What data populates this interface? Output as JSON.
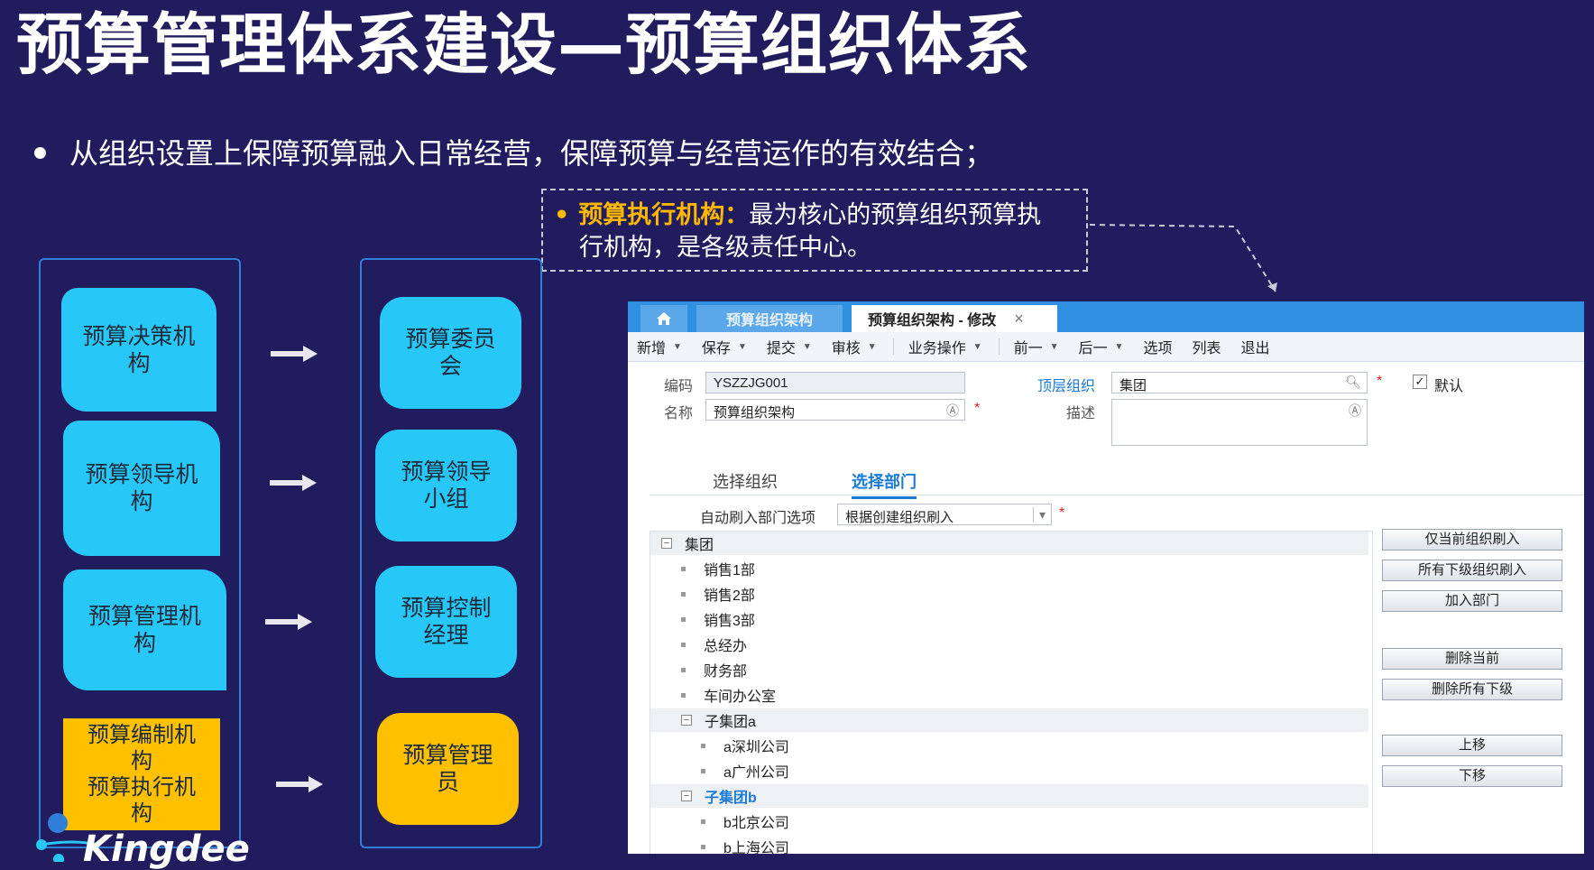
{
  "slide": {
    "title": "预算管理体系建设—预算组织体系",
    "bullet": "从组织设置上保障预算融入日常经营，保障预算与经营运作的有效结合；",
    "callout": {
      "key": "预算执行机构：",
      "text_line1": "最为核心的预算组织预算执",
      "text_line2": "行机构，是各级责任中心。"
    },
    "left_column": [
      {
        "line1": "预算决策机",
        "line2": "构"
      },
      {
        "line1": "预算领导机",
        "line2": "构"
      },
      {
        "line1": "预算管理机",
        "line2": "构"
      },
      {
        "line1": "预算编制机",
        "line2": "构",
        "line3": "预算执行机",
        "line4": "构"
      }
    ],
    "right_column": [
      {
        "line1": "预算委员",
        "line2": "会"
      },
      {
        "line1": "预算领导",
        "line2": "小组"
      },
      {
        "line1": "预算控制",
        "line2": "经理"
      },
      {
        "line1": "预算管理",
        "line2": "员"
      }
    ],
    "logo_text": "Kingdee",
    "colors": {
      "background": "#211c5e",
      "cyan": "#27c8f7",
      "yellow": "#ffc000",
      "accent_orange": "#ffb800"
    }
  },
  "app": {
    "tabs": [
      {
        "icon": "home-icon"
      },
      {
        "label": "预算组织架构"
      },
      {
        "label": "预算组织架构 - 修改",
        "close": "×"
      }
    ],
    "toolbar": [
      {
        "label": "新增",
        "dropdown": true
      },
      {
        "label": "保存",
        "dropdown": true
      },
      {
        "label": "提交",
        "dropdown": true
      },
      {
        "label": "审核",
        "dropdown": true
      },
      {
        "label": "业务操作",
        "dropdown": true
      },
      {
        "label": "前一",
        "dropdown": true
      },
      {
        "label": "后一",
        "dropdown": true
      },
      {
        "label": "选项",
        "dropdown": false
      },
      {
        "label": "列表",
        "dropdown": false
      },
      {
        "label": "退出",
        "dropdown": false
      }
    ],
    "form": {
      "code_label": "编码",
      "code_value": "YSZZJG001",
      "name_label": "名称",
      "name_value": "预算组织架构",
      "top_org_label": "顶层组织",
      "top_org_value": "集团",
      "desc_label": "描述",
      "desc_value": "",
      "default_label": "默认",
      "default_checked": true,
      "required_mark": "*"
    },
    "subtabs": [
      {
        "label": "选择组织",
        "active": false
      },
      {
        "label": "选择部门",
        "active": true
      }
    ],
    "auto_fill": {
      "label": "自动刷入部门选项",
      "value": "根据创建组织刷入"
    },
    "tree": [
      {
        "label": "集团",
        "level": 0,
        "toggle": "⊟",
        "group": true
      },
      {
        "label": "销售1部",
        "level": 1
      },
      {
        "label": "销售2部",
        "level": 1
      },
      {
        "label": "销售3部",
        "level": 1
      },
      {
        "label": "总经办",
        "level": 1
      },
      {
        "label": "财务部",
        "level": 1
      },
      {
        "label": "车间办公室",
        "level": 1
      },
      {
        "label": "子集团a",
        "level": 1,
        "toggle": "⊟",
        "group": true
      },
      {
        "label": "a深圳公司",
        "level": 2
      },
      {
        "label": "a广州公司",
        "level": 2
      },
      {
        "label": "子集团b",
        "level": 1,
        "toggle": "⊟",
        "group": true,
        "selected": true
      },
      {
        "label": "b北京公司",
        "level": 2
      },
      {
        "label": "b上海公司",
        "level": 2
      }
    ],
    "actions": [
      {
        "label": "仅当前组织刷入"
      },
      {
        "label": "所有下级组织刷入"
      },
      {
        "label": "加入部门"
      },
      {
        "label": "删除当前"
      },
      {
        "label": "删除所有下级"
      },
      {
        "label": "上移"
      },
      {
        "label": "下移"
      }
    ]
  }
}
